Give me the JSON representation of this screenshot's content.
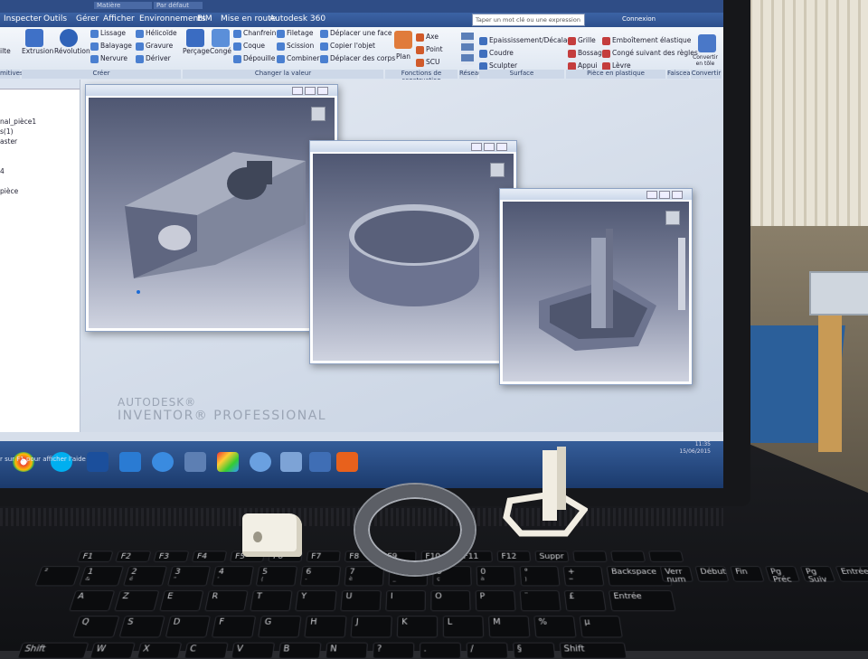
{
  "title_bar": {
    "material": "Matière",
    "display": "Par défaut",
    "search_placeholder": "Taper un mot clé ou une expression",
    "signin": "Connexion"
  },
  "tabs": [
    "Inspecter",
    "Outils",
    "Gérer",
    "Afficher",
    "Environnements",
    "BIM",
    "Mise en route",
    "Autodesk 360"
  ],
  "ribbon": {
    "create": {
      "label": "Créer",
      "left_cut": "ilte",
      "extrusion": "Extrusion",
      "revolution": "Révolution",
      "lissage": "Lissage",
      "balayage": "Balayage",
      "nervure": "Nervure",
      "helicoide": "Hélicoïde",
      "gravure": "Gravure",
      "deriver": "Dériver"
    },
    "primitives": "mitives",
    "modify": {
      "label": "Changer la valeur",
      "percage": "Perçage",
      "conge": "Congé",
      "chanfrein": "Chanfrein",
      "coque": "Coque",
      "depouille": "Dépouille",
      "filetage": "Filetage",
      "scission": "Scission",
      "combiner": "Combiner",
      "deplacer_face": "Déplacer une face",
      "copier_objet": "Copier l'objet",
      "deplacer_corps": "Déplacer des corps"
    },
    "construction": {
      "label": "Fonctions de construction",
      "plan": "Plan",
      "axe": "Axe",
      "point": "Point",
      "scu": "SCU"
    },
    "pattern": {
      "label": "Réseau"
    },
    "surface": {
      "label": "Surface",
      "epaississement": "Epaississement/Décalage",
      "coudre": "Coudre",
      "sculpter": "Sculpter"
    },
    "plastic": {
      "label": "Pièce en plastique",
      "grille": "Grille",
      "bossage": "Bossage",
      "appui": "Appui",
      "emboitement": "Emboîtement élastique",
      "conge_regles": "Congé suivant des règles",
      "levre": "Lèvre"
    },
    "harness": {
      "label": "Faisceau"
    },
    "convert": {
      "label": "Convertir",
      "btn": "Convertir en tôle"
    }
  },
  "browser": {
    "items": [
      "nal_pièce1",
      "s(1)",
      "aster",
      "",
      "",
      "4",
      "",
      "pièce"
    ]
  },
  "branding": {
    "line1": "AUTODESK®",
    "line2": "INVENTOR® PROFESSIONAL"
  },
  "status": {
    "help": "r sur F1 pour afficher l'aide"
  },
  "clock": {
    "time": "11:35",
    "date": "15/06/2015"
  },
  "keyboard": {
    "row_fn": [
      "F1",
      "F2",
      "F3",
      "F4",
      "F5",
      "F6",
      "F7",
      "F8",
      "F9",
      "F10",
      "F11",
      "F12",
      "Suppr",
      "",
      "",
      ""
    ],
    "row_num": [
      [
        "²",
        ""
      ],
      [
        "1",
        "&"
      ],
      [
        "2",
        "é"
      ],
      [
        "3",
        "\""
      ],
      [
        "4",
        "'"
      ],
      [
        "5",
        "("
      ],
      [
        "6",
        "-"
      ],
      [
        "7",
        "è"
      ],
      [
        "8",
        "_"
      ],
      [
        "9",
        "ç"
      ],
      [
        "0",
        "à"
      ],
      [
        "°",
        ")"
      ],
      [
        "+",
        "="
      ],
      [
        "Backspace",
        ""
      ]
    ],
    "row_top": [
      "A",
      "Z",
      "E",
      "R",
      "T",
      "Y",
      "U",
      "I",
      "O",
      "P",
      "¨",
      "£",
      "Entrée"
    ],
    "row_mid": [
      "Q",
      "S",
      "D",
      "F",
      "G",
      "H",
      "J",
      "K",
      "L",
      "M",
      "%",
      "µ"
    ],
    "row_bot": [
      "Shift",
      "W",
      "X",
      "C",
      "V",
      "B",
      "N",
      "?",
      ".",
      "/",
      "§",
      "Shift"
    ],
    "nav": [
      "Verr num",
      "Début",
      "Fin",
      "Pg Préc",
      "Pg Suiv",
      "Entrée"
    ]
  },
  "colors": {
    "ribbon_blue": "#2d4f8c",
    "viewport_top": "#4f5772",
    "taskbar": "#1b3a6c",
    "printed_white": "#f2efe5",
    "ring_grey": "#5c5f66"
  }
}
